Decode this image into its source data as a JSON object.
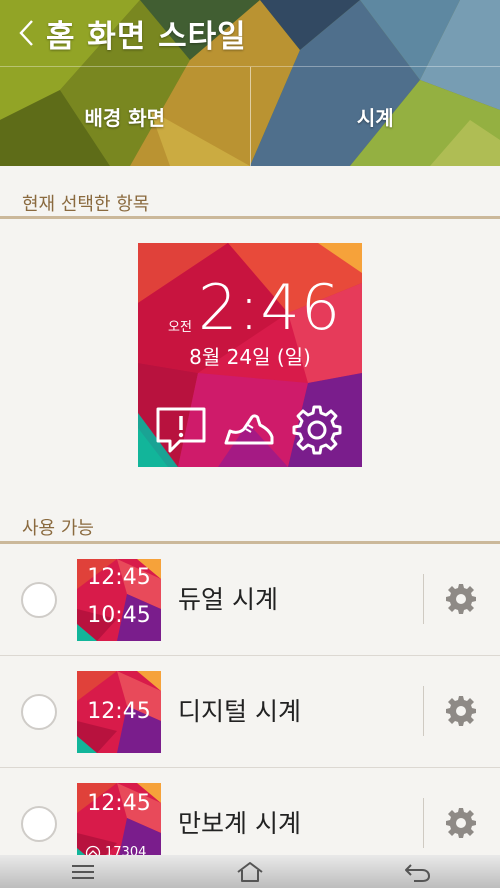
{
  "header": {
    "title": "홈 화면 스타일",
    "tabs": [
      {
        "label": "배경 화면",
        "selected": false
      },
      {
        "label": "시계",
        "selected": true
      }
    ]
  },
  "current": {
    "section_title": "현재 선택한 항목",
    "ampm": "오전",
    "time": "2:46",
    "date": "8월 24일 (일)",
    "icons": [
      "alert-icon",
      "shoe-icon",
      "gear-icon"
    ]
  },
  "available": {
    "section_title": "사용 가능",
    "items": [
      {
        "label": "듀얼 시계",
        "thumb_line1": "12:45",
        "thumb_line2": "10:45",
        "selected": false
      },
      {
        "label": "디지털 시계",
        "thumb_line1": "12:45",
        "selected": false
      },
      {
        "label": "만보계 시계",
        "thumb_line1": "12:45",
        "thumb_steps": "17304",
        "selected": false
      }
    ]
  },
  "colors": {
    "accent": "#8a6a3f",
    "section_line": "#cbb89a",
    "background": "#f5f4f1"
  },
  "navbar": {
    "icons": [
      "menu-icon",
      "home-icon",
      "back-icon"
    ]
  }
}
